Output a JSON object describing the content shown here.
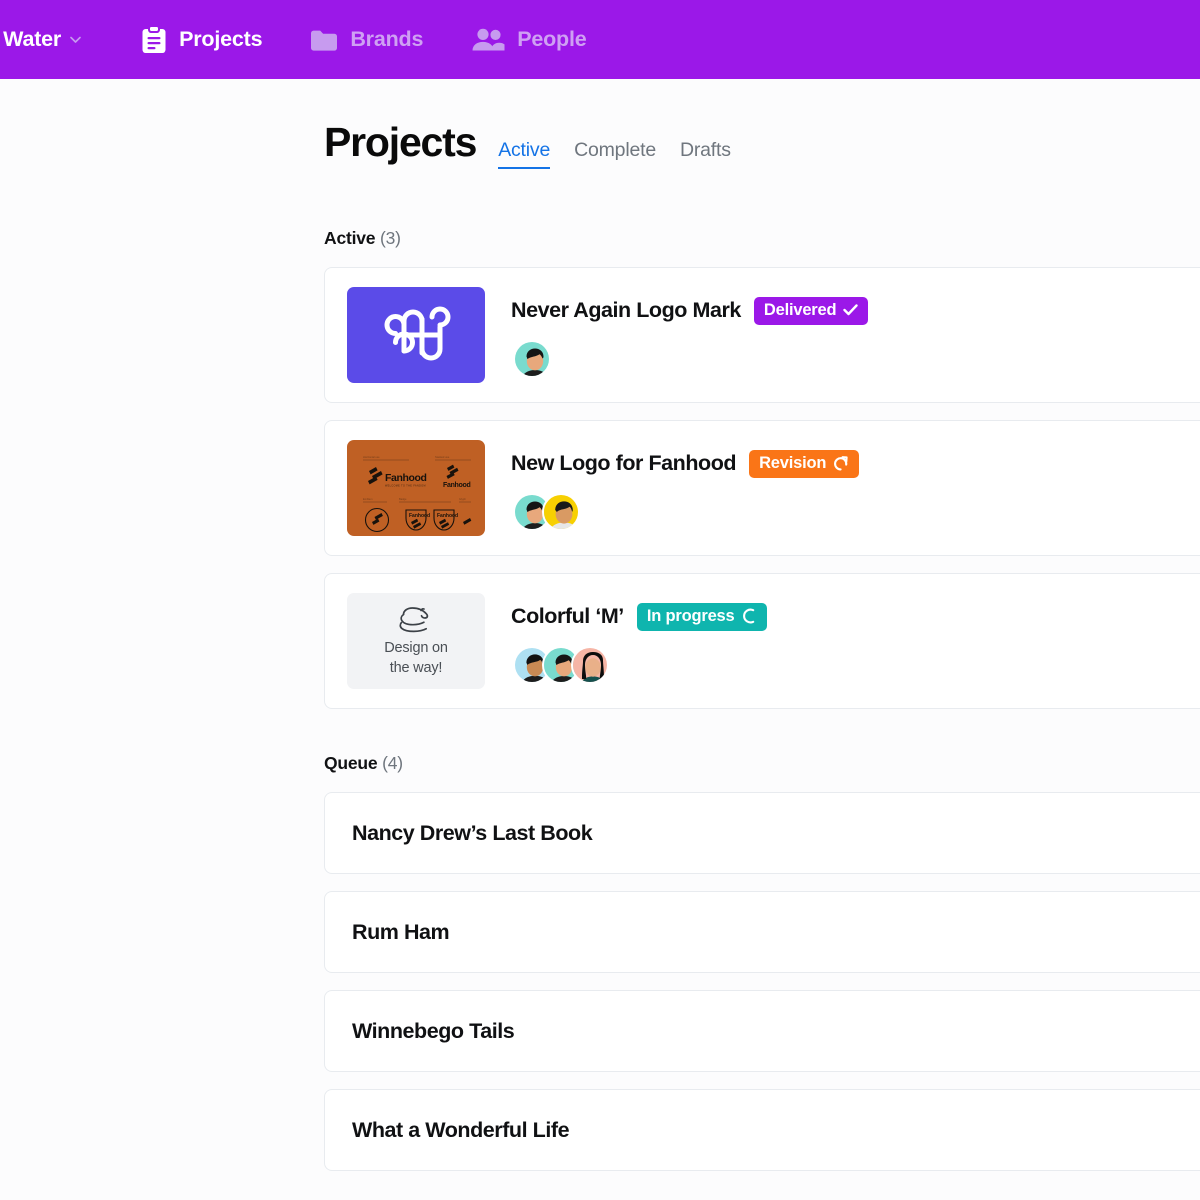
{
  "nav": {
    "brand": {
      "label": "nsby Water",
      "caret_icon": "chevron-down-icon"
    },
    "items": [
      {
        "label": "Projects",
        "icon": "clipboard-icon",
        "state": "active"
      },
      {
        "label": "Brands",
        "icon": "folder-icon",
        "state": "inactive"
      },
      {
        "label": "People",
        "icon": "people-icon",
        "state": "inactive"
      }
    ]
  },
  "header": {
    "title": "Projects",
    "tabs": [
      {
        "label": "Active",
        "selected": true
      },
      {
        "label": "Complete",
        "selected": false
      },
      {
        "label": "Drafts",
        "selected": false
      }
    ]
  },
  "active_section": {
    "name": "Active",
    "count": "(3)",
    "projects": [
      {
        "title": "Never Again Logo Mark",
        "status": {
          "label": "Delivered",
          "icon": "check-icon",
          "color": "#9B18E8"
        },
        "thumbnail": "monogram-logo-thumbnail",
        "avatars": [
          "avatar-1"
        ]
      },
      {
        "title": "New Logo for Fanhood",
        "status": {
          "label": "Revision",
          "icon": "refresh-icon",
          "color": "#FA7517"
        },
        "thumbnail": "fanhood-brand-sheet-thumbnail",
        "brand_word": "Fanhood",
        "avatars": [
          "avatar-1",
          "avatar-2"
        ]
      },
      {
        "title": "Colorful ‘M’",
        "status": {
          "label": "In progress",
          "icon": "spinner-icon",
          "color": "#0FB5AE"
        },
        "thumbnail": "design-placeholder-thumbnail",
        "placeholder_line1": "Design on",
        "placeholder_line2": "the way!",
        "avatars": [
          "avatar-3",
          "avatar-1",
          "avatar-4"
        ]
      }
    ]
  },
  "queue_section": {
    "name": "Queue",
    "count": "(4)",
    "items": [
      {
        "title": "Nancy Drew’s Last Book"
      },
      {
        "title": "Rum Ham"
      },
      {
        "title": "Winnebego Tails"
      },
      {
        "title": "What a Wonderful Life"
      }
    ]
  },
  "colors": {
    "brand_purple": "#9B18E8",
    "tab_blue": "#1473E6",
    "revision_orange": "#FA7517",
    "progress_teal": "#0FB5AE",
    "page_background": "#FCFCFD"
  }
}
